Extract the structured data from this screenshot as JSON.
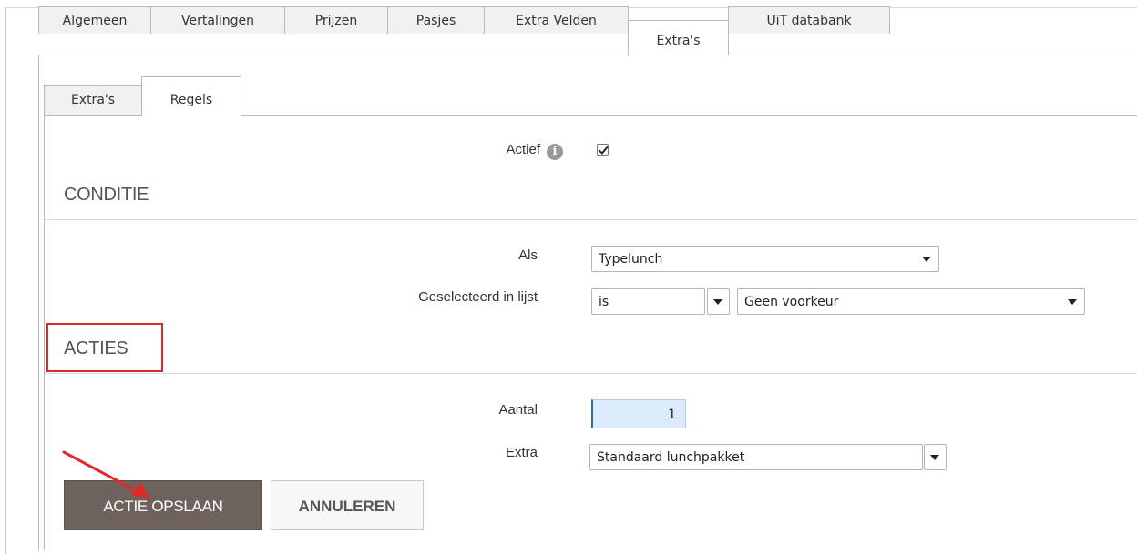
{
  "tabs": [
    {
      "label": "Algemeen",
      "active": false
    },
    {
      "label": "Vertalingen",
      "active": false
    },
    {
      "label": "Prijzen",
      "active": false
    },
    {
      "label": "Pasjes",
      "active": false
    },
    {
      "label": "Extra Velden",
      "active": false
    },
    {
      "label": "Extra's",
      "active": true
    },
    {
      "label": "UiT databank",
      "active": false
    }
  ],
  "sub_tabs": [
    {
      "label": "Extra's",
      "active": false
    },
    {
      "label": "Regels",
      "active": true
    }
  ],
  "form": {
    "actief_label": "Actief",
    "actief_checked": true,
    "info_glyph": "i",
    "conditie_title": "CONDITIE",
    "als_label": "Als",
    "als_value": "Typelunch",
    "geselecteerd_label": "Geselecteerd in lijst",
    "operator_value": "is",
    "list_value": "Geen voorkeur",
    "acties_title": "ACTIES",
    "aantal_label": "Aantal",
    "aantal_value": "1",
    "extra_label": "Extra",
    "extra_value": "Standaard lunchpakket"
  },
  "buttons": {
    "save_label": "ACTIE OPSLAAN",
    "cancel_label": "ANNULEREN"
  },
  "colors": {
    "primary_button": "#6e625c",
    "annotation_red": "#e0282a",
    "input_highlight": "#dcebfb"
  },
  "icons": {
    "info": "info-icon",
    "checkbox": "checkbox-checked",
    "dropdown": "chevron-down-icon",
    "annotation_arrow": "red-arrow-icon"
  }
}
